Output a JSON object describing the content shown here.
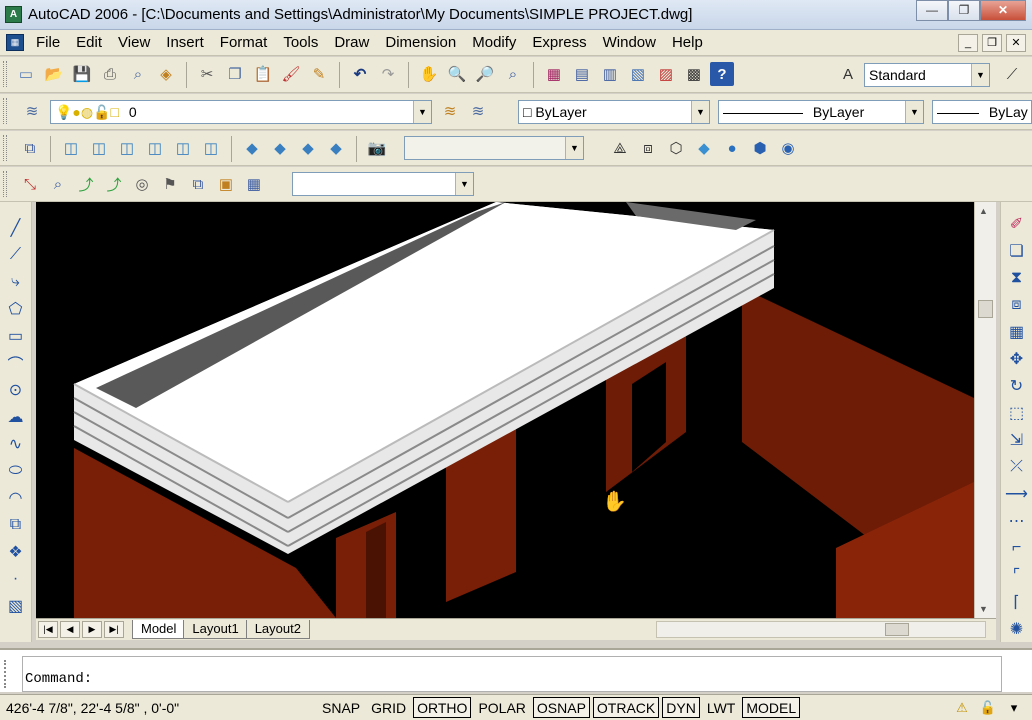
{
  "title": "AutoCAD 2006 - [C:\\Documents and Settings\\Administrator\\My Documents\\SIMPLE PROJECT.dwg]",
  "window_controls": {
    "minimize": "—",
    "maximize": "❐",
    "close": "✕"
  },
  "menu": [
    "File",
    "Edit",
    "View",
    "Insert",
    "Format",
    "Tools",
    "Draw",
    "Dimension",
    "Modify",
    "Express",
    "Window",
    "Help"
  ],
  "mdi_controls": {
    "minimize": "_",
    "restore": "❐",
    "close": "✕"
  },
  "toolbar_standard": {
    "icons": [
      "new-icon",
      "open-icon",
      "save-icon",
      "print-icon",
      "print-preview-icon",
      "publish-icon",
      "cut-icon",
      "copy-icon",
      "paste-icon",
      "match-properties-icon",
      "block-editor-icon",
      "undo-icon",
      "redo-icon",
      "pan-icon",
      "zoom-realtime-icon",
      "zoom-window-icon",
      "zoom-previous-icon",
      "properties-icon",
      "design-center-icon",
      "tool-palettes-icon",
      "sheet-set-icon",
      "markup-icon",
      "calculator-icon",
      "help-icon"
    ],
    "text_style_value": "Standard"
  },
  "toolbar_layers": {
    "layer_value": "0",
    "color_value": "ByLayer",
    "linetype_value": "ByLayer",
    "lineweight_value": "ByLay"
  },
  "toolbar_views": {
    "icons": [
      "named-views-icon",
      "top-view-icon",
      "bottom-view-icon",
      "left-view-icon",
      "right-view-icon",
      "front-view-icon",
      "back-view-icon",
      "sw-iso-icon",
      "se-iso-icon",
      "ne-iso-icon",
      "nw-iso-icon",
      "camera-icon"
    ],
    "shade_icons": [
      "2d-wireframe-icon",
      "3d-wireframe-icon",
      "hidden-icon",
      "flat-shaded-icon",
      "gouraud-icon",
      "flat-edges-icon",
      "gouraud-edges-icon"
    ]
  },
  "toolbar_ucs": {
    "icons": [
      "ucs-icon",
      "world-ucs-icon",
      "object-ucs-icon",
      "face-ucs-icon",
      "view-ucs-icon",
      "origin-ucs-icon",
      "z-axis-ucs-icon",
      "3point-ucs-icon",
      "ucs-apply-icon"
    ]
  },
  "draw_tools": [
    "line-icon",
    "construction-line-icon",
    "polyline-icon",
    "polygon-icon",
    "rectangle-icon",
    "arc-icon",
    "circle-icon",
    "revcloud-icon",
    "spline-icon",
    "ellipse-icon",
    "ellipse-arc-icon",
    "insert-block-icon",
    "make-block-icon",
    "point-icon",
    "hatch-icon"
  ],
  "modify_tools": [
    "erase-icon",
    "copy-object-icon",
    "mirror-icon",
    "offset-icon",
    "array-icon",
    "move-icon",
    "rotate-icon",
    "scale-icon",
    "stretch-icon",
    "trim-icon",
    "extend-icon",
    "break-icon",
    "join-icon",
    "chamfer-icon",
    "fillet-icon",
    "explode-icon"
  ],
  "layout_tabs": [
    "Model",
    "Layout1",
    "Layout2"
  ],
  "active_tab": "Model",
  "command_prompt": "Command:",
  "coordinates": "426'-4 7/8\",  22'-4 5/8\" , 0'-0\"",
  "status_buttons": [
    {
      "label": "SNAP",
      "on": false
    },
    {
      "label": "GRID",
      "on": false
    },
    {
      "label": "ORTHO",
      "on": true
    },
    {
      "label": "POLAR",
      "on": false
    },
    {
      "label": "OSNAP",
      "on": true
    },
    {
      "label": "OTRACK",
      "on": true
    },
    {
      "label": "DYN",
      "on": true
    },
    {
      "label": "LWT",
      "on": false
    },
    {
      "label": "MODEL",
      "on": true
    }
  ],
  "colors": {
    "wall": "#7a1f07",
    "wall_dark": "#4a1202",
    "slab_top": "#ffffff",
    "slab_shade": "#5a5a5a",
    "canvas": "#000000"
  }
}
